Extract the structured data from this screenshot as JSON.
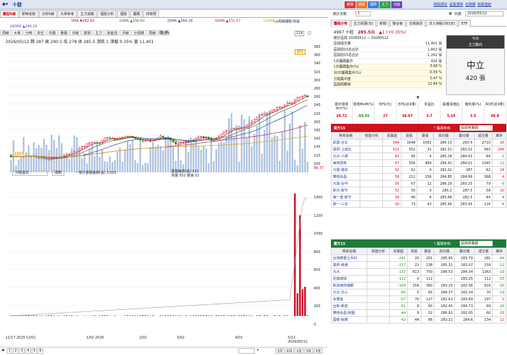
{
  "app": {
    "stock_label": "十銓"
  },
  "top_buttons": [
    {
      "label": "報價",
      "color": "#d33"
    },
    {
      "label": "期貨",
      "color": "#e8762c"
    },
    {
      "label": "國際",
      "color": "#3a7bd5"
    },
    {
      "label": "主力",
      "color": "#2f9e44"
    },
    {
      "label": "功能",
      "color": "#7a3fc4"
    }
  ],
  "top_links": [
    "期貨網址",
    "設置選單",
    "任務欄",
    "點擊連結"
  ],
  "chart_tabs": [
    "圖型K線",
    "即時走勢",
    "分析K線",
    "大單參考",
    "主力追蹤",
    "個股分析",
    "個股",
    "籌碼",
    "四象限"
  ],
  "ma_legend": [
    {
      "label": "5MA ▼282.60",
      "color": "#d0021b"
    },
    {
      "label": "10MA ▲290.60",
      "color": "#2a7a2a"
    },
    {
      "label": "20MA ▲264.28",
      "color": "#1a3f9a"
    },
    {
      "label": "60MA ▲231.57",
      "color": "#c2185b"
    },
    {
      "label": "120MA ▲212.33",
      "color": "#e0a000"
    },
    {
      "label": "240MA ▲246.29",
      "color": "#7a3fc4"
    }
  ],
  "legend_extra": "○ 均線優勢/突破",
  "toolbar": [
    "周線",
    "大單",
    "分時",
    "多空",
    "均價",
    "量價",
    "日線",
    "檢視",
    "主力",
    "資金流",
    "月線",
    "分週期",
    "周線",
    "日期"
  ],
  "price_info": "2026/05/12 開 287 高 290.5 低 278 收 285.5 漲跌 1 漲幅 0.35% 量 11,401",
  "price_axis": [
    "380",
    "360",
    "340",
    "320",
    "300",
    "280",
    "260",
    "240",
    "220",
    "200",
    "180",
    "160",
    "140",
    "120",
    "100"
  ],
  "price_tag": "303",
  "last_price_tag": "89.37",
  "ma_axis_tag": "122.5",
  "lower": {
    "title": "分點進出",
    "btn": "總數",
    "stat_a": "一累計賣賣差額(張) 3,025",
    "stat_b": "賣賣差額(張) 521",
    "stat_c": "買賣 552 賣張 31",
    "axis": [
      "1400",
      "1200",
      "1000",
      "800",
      "600",
      "400",
      "200",
      "0"
    ]
  },
  "dates": [
    "11/17 2025",
    "12/01",
    "1/02 2026",
    "2/02",
    "3/02",
    "4/01",
    "5/12 2026/05/12"
  ],
  "bottom_pages": [
    "1",
    "2",
    "3",
    "4",
    "5",
    "6"
  ],
  "bottom_buttons": [
    "3月",
    "6月",
    "1年",
    "3年",
    "5年"
  ],
  "right": {
    "header_label": "統計天數",
    "header_value": "1",
    "date_label": "日期",
    "date_value": "2026/05/12",
    "tabs": [
      "籌碼分佈",
      "主力買賣(日)",
      "新聞",
      "聯合板",
      "交易資訊",
      "法人持股(363天)",
      "ETF"
    ],
    "stock_code": "4967 十銓",
    "stock_price": "285.5元",
    "stock_change": "▲1 (+0.35%)",
    "stats_title": "統計區間 20260512 ~ 20260512",
    "stats": [
      {
        "k": "區間成交量",
        "v": "11,401 張"
      },
      {
        "k": "區間前15名合計",
        "v": "1,662 張"
      },
      {
        "k": "區間前15名合計",
        "v": "-1,242 張"
      },
      {
        "k": "1日籌碼集中",
        "v": "420 張"
      },
      {
        "k": "1日籌碼集中(%)",
        "v": "3.68 %"
      },
      {
        "k": "20日籌碼集中(%)",
        "v": "-0.56 %"
      },
      {
        "k": "分點集中度",
        "v": "0.47 %"
      },
      {
        "k": "區間周轉率",
        "v": "12.84 %"
      }
    ],
    "box_title": "今日",
    "box_sub": "主力動向",
    "box_state": "中立",
    "box_value": "420 張",
    "fundamentals_head": [
      "累計營收YoY(%)",
      "營收MoM(%)",
      "EPS(元)",
      "EPS(近4季)",
      "本益比",
      "股價淨值比",
      "殖利率(%)",
      "ROE(近4季)"
    ],
    "fundamentals_val": [
      "29.72",
      "-59.01",
      "27",
      "39.07",
      "3.7",
      "5.19",
      "3.5",
      "66.8"
    ],
    "buy_title": "買方15",
    "sell_title": "賣方15",
    "pager": "? 籌碼券商:",
    "pager_sel": "區間買賣超",
    "cols": [
      "券商名稱",
      "營建分析",
      "買賣超",
      "買張",
      "賣張",
      "買均價",
      "賣均價",
      "成交量",
      "庫存"
    ],
    "buy_rows": [
      [
        "凱基-台北",
        "",
        584,
        1648,
        1062,
        284.13,
        283.4,
        2710,
        16
      ],
      [
        "富邦-土城北",
        "",
        521,
        552,
        31,
        282.51,
        283.02,
        583,
        168
      ],
      [
        "元大-小港",
        "",
        81,
        85,
        4,
        285.28,
        284.93,
        89,
        -1
      ],
      [
        "美林證券",
        "",
        67,
        556,
        489,
        284.41,
        284.01,
        1045,
        -12
      ],
      [
        "元富-南京",
        "",
        62,
        62,
        0,
        282.02,
        287,
        62,
        24
      ],
      [
        "華南永昌",
        "",
        56,
        212,
        156,
        284.85,
        284.89,
        368,
        4
      ],
      [
        "元富-台中",
        "",
        55,
        67,
        12,
        286.29,
        283.25,
        79,
        -9
      ],
      [
        "新光-新竹",
        "",
        52,
        55,
        3,
        285.2,
        287.5,
        58,
        10
      ],
      [
        "第一金-新竹",
        "",
        36,
        40,
        4,
        283.66,
        282.5,
        44,
        4
      ],
      [
        "統一-三多",
        "",
        30,
        73,
        43,
        285.96,
        283.95,
        116,
        -4
      ]
    ],
    "sell_rows": [
      [
        "台灣摩根士丹利",
        "",
        -241,
        20,
        261,
        285.95,
        283.79,
        281,
        -44
      ],
      [
        "富邦-南港",
        "",
        -217,
        21,
        238,
        285.31,
        283.07,
        259,
        -12
      ],
      [
        "元大",
        "",
        -137,
        613,
        750,
        284.53,
        284.34,
        1363,
        -19
      ],
      [
        "花旗環球",
        "",
        -112,
        0,
        112,
        "--",
        283.25,
        112,
        -25
      ],
      [
        "新加坡商瑞銀",
        "",
        -104,
        256,
        360,
        283.25,
        283.36,
        616,
        -20
      ],
      [
        "元大-文心",
        "",
        -60,
        5,
        65,
        284.37,
        282.34,
        70,
        -19
      ],
      [
        "永豐金",
        "",
        -57,
        70,
        127,
        282.61,
        283.89,
        197,
        0
      ],
      [
        "台新-新莊",
        "",
        -51,
        8,
        60,
        282.45,
        284.73,
        69,
        -16
      ],
      [
        "華南永昌-桃園",
        "",
        -44,
        8,
        52,
        286.92,
        282.05,
        60,
        -26
      ],
      [
        "國泰-板橋",
        "",
        -42,
        44,
        86,
        283.22,
        284.6,
        134,
        12
      ]
    ]
  },
  "chart_data": {
    "type": "candlestick",
    "price_ylim": [
      80,
      380
    ],
    "volume_ylim": [
      0,
      1500
    ]
  }
}
